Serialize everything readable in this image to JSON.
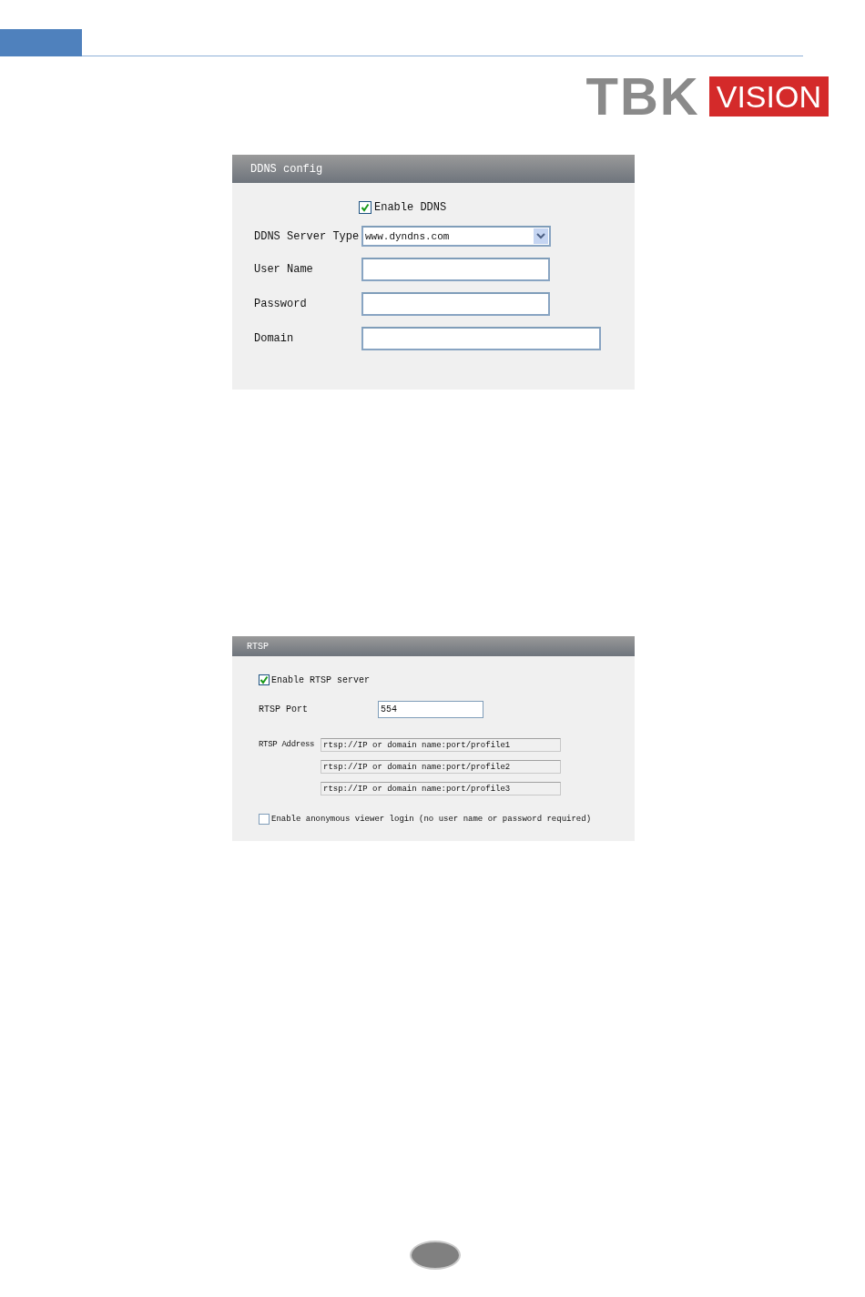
{
  "logo": {
    "left": "TBK",
    "right": "VISION"
  },
  "ddns": {
    "title": "DDNS config",
    "enable": {
      "label": "Enable DDNS",
      "checked": true
    },
    "fields": [
      {
        "kind": "select",
        "label": "DDNS Server Type",
        "value": "www.dyndns.com"
      },
      {
        "kind": "text",
        "label": "User Name"
      },
      {
        "kind": "text",
        "label": "Password"
      },
      {
        "kind": "wide",
        "label": "Domain"
      }
    ]
  },
  "rtsp": {
    "title": "RTSP",
    "enable": {
      "label": "Enable RTSP server",
      "checked": true
    },
    "port": {
      "label": "RTSP Port",
      "value": "554"
    },
    "address": {
      "label": "RTSP Address",
      "values": [
        "rtsp://IP or domain name:port/profile1",
        "rtsp://IP or domain name:port/profile2",
        "rtsp://IP or domain name:port/profile3"
      ]
    },
    "anonymous": {
      "label": "Enable anonymous viewer login (no user name or password required)",
      "checked": false
    }
  }
}
